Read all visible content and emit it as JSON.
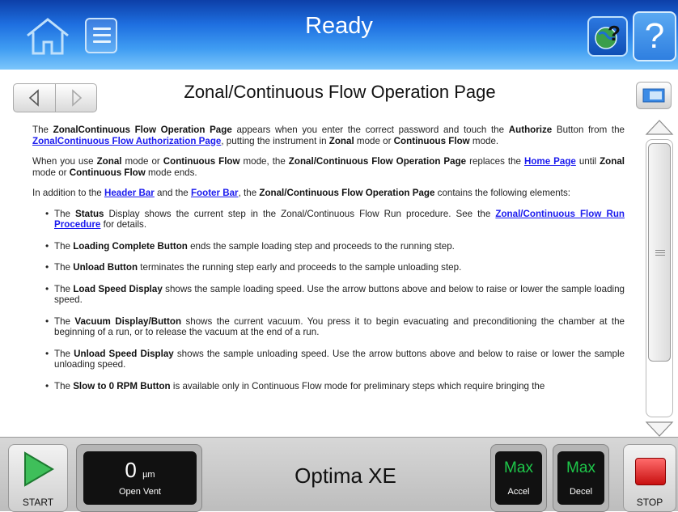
{
  "header": {
    "title": "Ready",
    "help_label": "?",
    "icons": [
      "home-icon",
      "menu-icon",
      "globe-help-icon",
      "help-icon"
    ]
  },
  "page": {
    "title": "Zonal/Continuous Flow Operation Page"
  },
  "content": {
    "p1": {
      "t1": "The ",
      "b1": "ZonalContinuous Flow Operation Page",
      "t2": " appears when you enter the correct password and touch the ",
      "b2": "Authorize",
      "t3": " Button from the ",
      "link": "ZonalContinuous Flow Authorization Page",
      "t4": ", putting the instrument in ",
      "b3": "Zonal",
      "t5": " mode or ",
      "b4": "Continuous Flow",
      "t6": " mode."
    },
    "p2": {
      "t1": "When you use ",
      "b1": "Zonal",
      "t2": " mode or ",
      "b2": "Continuous Flow",
      "t3": " mode, the ",
      "b3": "Zonal/Continuous Flow Operation Page",
      "t4": " replaces the ",
      "link": "Home Page",
      "t5": " until ",
      "b4": "Zonal",
      "t6": " mode or ",
      "b5": "Continuous Flow",
      "t7": " mode ends."
    },
    "p3": {
      "t1": "In addition to the ",
      "link1": "Header Bar",
      "t2": " and the ",
      "link2": "Footer Bar",
      "t3": ", the ",
      "b1": "Zonal/Continuous Flow Operation Page",
      "t4": " contains the following elements:"
    },
    "bullets": [
      {
        "t1": "The ",
        "b": "Status",
        "t2": " Display shows the current step in the Zonal/Continuous Flow Run procedure. See the ",
        "link": "Zonal/Continuous Flow Run Procedure",
        "t3": " for details."
      },
      {
        "t1": "The ",
        "b": "Loading Complete Button",
        "t2": " ends the sample loading step and proceeds to the running step."
      },
      {
        "t1": "The ",
        "b": "Unload Button",
        "t2": " terminates the running step early and proceeds to the sample unloading step."
      },
      {
        "t1": "The ",
        "b": "Load Speed Display",
        "t2": " shows the sample loading speed. Use the arrow buttons above and below to raise or lower the sample loading speed."
      },
      {
        "t1": "The ",
        "b": "Vacuum Display/Button",
        "t2": " shows the current vacuum. You press it to begin evacuating and preconditioning the chamber at the beginning of a run, or to release the vacuum at the end of a run."
      },
      {
        "t1": "The ",
        "b": "Unload Speed Display",
        "t2": " shows the sample unloading speed. Use the arrow buttons above and below to raise or lower the sample unloading speed."
      },
      {
        "t1": "The ",
        "b": "Slow to 0 RPM Button",
        "t2": " is available only in Continuous Flow mode for preliminary steps which require bringing the"
      }
    ]
  },
  "footer": {
    "start_label": "START",
    "stop_label": "STOP",
    "vacuum_value": "0",
    "vacuum_unit": "µm",
    "vacuum_label": "Open Vent",
    "model": "Optima XE",
    "accel_value": "Max",
    "accel_label": "Accel",
    "decel_value": "Max",
    "decel_label": "Decel"
  },
  "colors": {
    "header_top": "#0d3fa8",
    "header_bottom": "#7cc6fb",
    "link": "#1a1aee",
    "speed_text": "#1ec84a",
    "start_green": "#3fbf5a",
    "stop_red": "#d11a1a"
  }
}
